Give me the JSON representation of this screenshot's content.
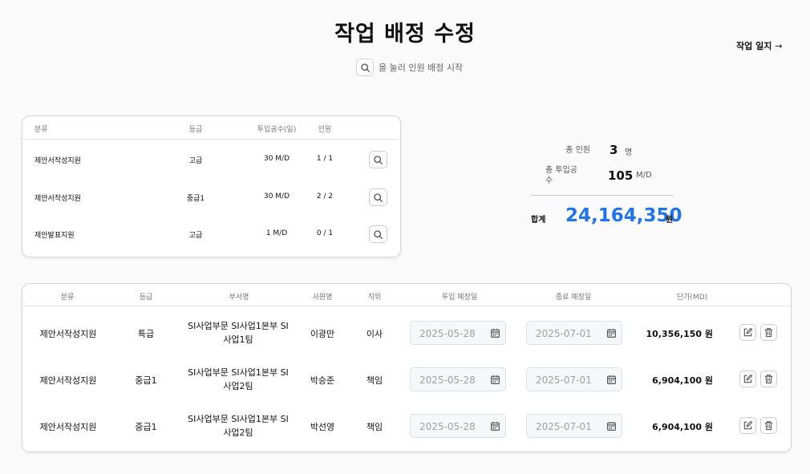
{
  "page": {
    "title": "작업 배정 수정",
    "journal_link": "작업 일지",
    "journal_arrow": "→",
    "hint": "을 눌러 인원 배정 시작"
  },
  "summary_table": {
    "headers": [
      "분류",
      "등급",
      "투입공수(일)",
      "인원"
    ],
    "rows": [
      {
        "category": "제안서작성지원",
        "grade": "고급",
        "effort": "30 M/D",
        "people": "1 / 1"
      },
      {
        "category": "제안서작성지원",
        "grade": "중급1",
        "effort": "30 M/D",
        "people": "2 / 2"
      },
      {
        "category": "제안발표지원",
        "grade": "고급",
        "effort": "1 M/D",
        "people": "0 / 1"
      }
    ]
  },
  "totals": {
    "people_label": "총 인원",
    "people_value": "3",
    "people_unit": "명",
    "effort_label_line1": "총 투입공",
    "effort_label_line2": "수",
    "effort_value": "105",
    "effort_unit": "M/D",
    "grand_label": "합계",
    "grand_value": "24,164,350",
    "grand_unit": "원"
  },
  "detail_table": {
    "headers": [
      "분류",
      "등급",
      "부서명",
      "사원명",
      "직위",
      "투입 예정일",
      "종료 예정일",
      "단가(MD)"
    ],
    "rows": [
      {
        "category": "제안서작성지원",
        "grade": "특급",
        "dept_line1": "SI사업부문 SI사업1본부 SI",
        "dept_line2": "사업1팀",
        "name": "이광만",
        "position": "이사",
        "start": "2025-05-28",
        "end": "2025-07-01",
        "price": "10,356,150 원"
      },
      {
        "category": "제안서작성지원",
        "grade": "중급1",
        "dept_line1": "SI사업부문 SI사업1본부 SI",
        "dept_line2": "사업2팀",
        "name": "박승준",
        "position": "책임",
        "start": "2025-05-28",
        "end": "2025-07-01",
        "price": "6,904,100 원"
      },
      {
        "category": "제안서작성지원",
        "grade": "중급1",
        "dept_line1": "SI사업부문 SI사업1본부 SI",
        "dept_line2": "사업2팀",
        "name": "박선영",
        "position": "책임",
        "start": "2025-05-28",
        "end": "2025-07-01",
        "price": "6,904,100 원"
      }
    ]
  },
  "icons": {
    "search": "search-icon",
    "calendar": "calendar-icon",
    "edit": "edit-icon",
    "delete": "trash-icon"
  },
  "colors": {
    "accent": "#1f74ea",
    "border": "#d4d7dc",
    "background": "#fafafb"
  }
}
